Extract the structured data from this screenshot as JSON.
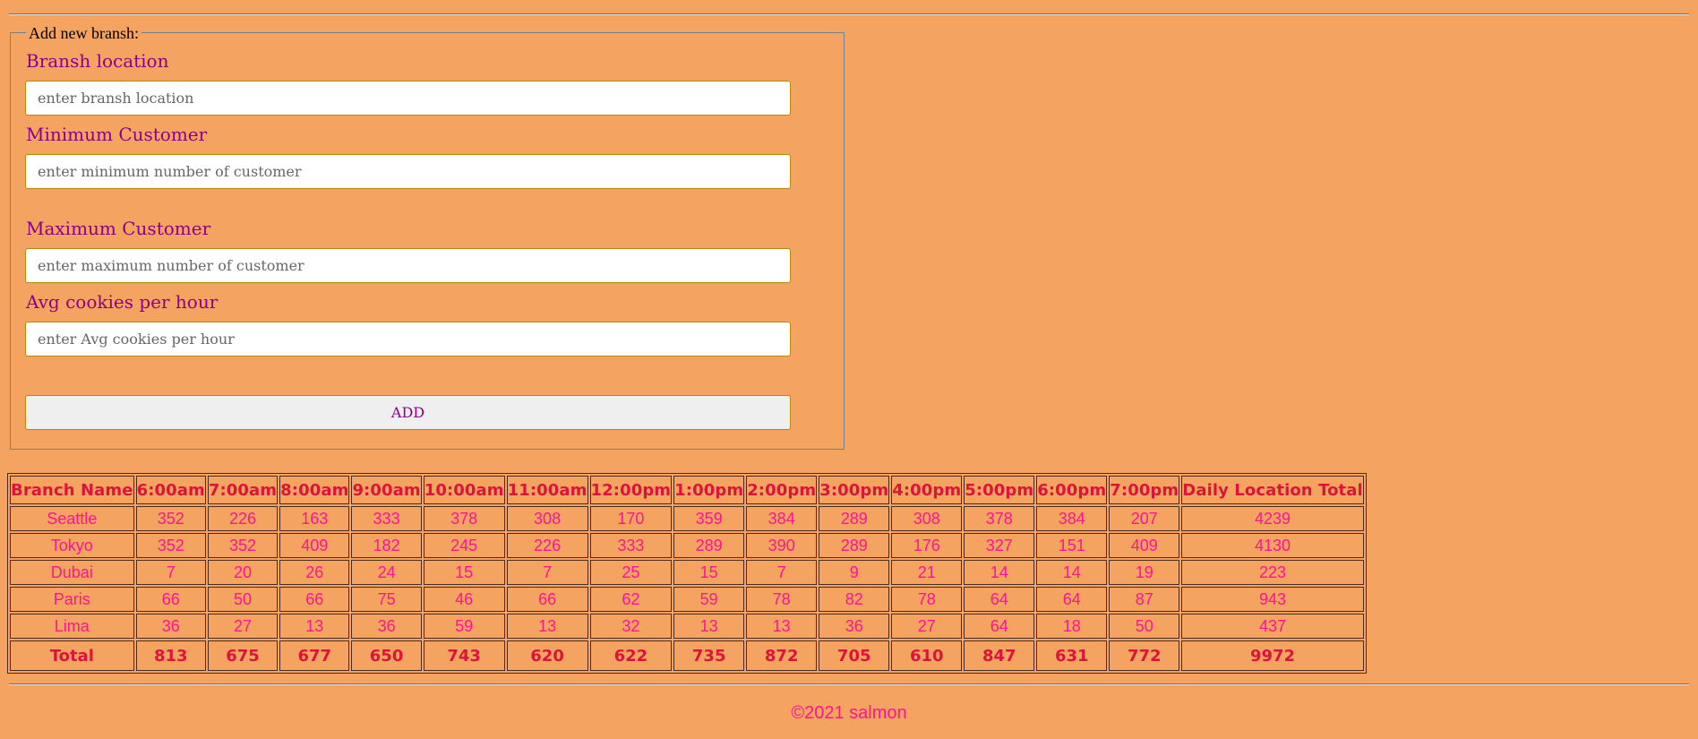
{
  "form": {
    "legend": "Add new bransh:",
    "fields": [
      {
        "label": "Bransh location",
        "placeholder": "enter bransh location",
        "value": ""
      },
      {
        "label": "Minimum Customer",
        "placeholder": "enter minimum number of customer",
        "value": ""
      },
      {
        "label": "Maximum Customer",
        "placeholder": "enter maximum number of customer",
        "value": ""
      },
      {
        "label": "Avg cookies per hour",
        "placeholder": "enter Avg cookies per hour",
        "value": ""
      }
    ],
    "add_label": "ADD"
  },
  "table": {
    "headers": [
      "Branch Name",
      "6:00am",
      "7:00am",
      "8:00am",
      "9:00am",
      "10:00am",
      "11:00am",
      "12:00pm",
      "1:00pm",
      "2:00pm",
      "3:00pm",
      "4:00pm",
      "5:00pm",
      "6:00pm",
      "7:00pm",
      "Daily Location Total"
    ],
    "rows": [
      [
        "Seattle",
        "352",
        "226",
        "163",
        "333",
        "378",
        "308",
        "170",
        "359",
        "384",
        "289",
        "308",
        "378",
        "384",
        "207",
        "4239"
      ],
      [
        "Tokyo",
        "352",
        "352",
        "409",
        "182",
        "245",
        "226",
        "333",
        "289",
        "390",
        "289",
        "176",
        "327",
        "151",
        "409",
        "4130"
      ],
      [
        "Dubai",
        "7",
        "20",
        "26",
        "24",
        "15",
        "7",
        "25",
        "15",
        "7",
        "9",
        "21",
        "14",
        "14",
        "19",
        "223"
      ],
      [
        "Paris",
        "66",
        "50",
        "66",
        "75",
        "46",
        "66",
        "62",
        "59",
        "78",
        "82",
        "78",
        "64",
        "64",
        "87",
        "943"
      ],
      [
        "Lima",
        "36",
        "27",
        "13",
        "36",
        "59",
        "13",
        "32",
        "13",
        "13",
        "36",
        "27",
        "64",
        "18",
        "50",
        "437"
      ]
    ],
    "totals": [
      "Total",
      "813",
      "675",
      "677",
      "650",
      "743",
      "620",
      "622",
      "735",
      "872",
      "705",
      "610",
      "847",
      "631",
      "772",
      "9972"
    ]
  },
  "footer": {
    "text": "©2021 salmon"
  },
  "colors": {
    "background": "#F4A460",
    "label": "#8B008B",
    "header": "#DC143C",
    "cell": "#FF1493"
  }
}
